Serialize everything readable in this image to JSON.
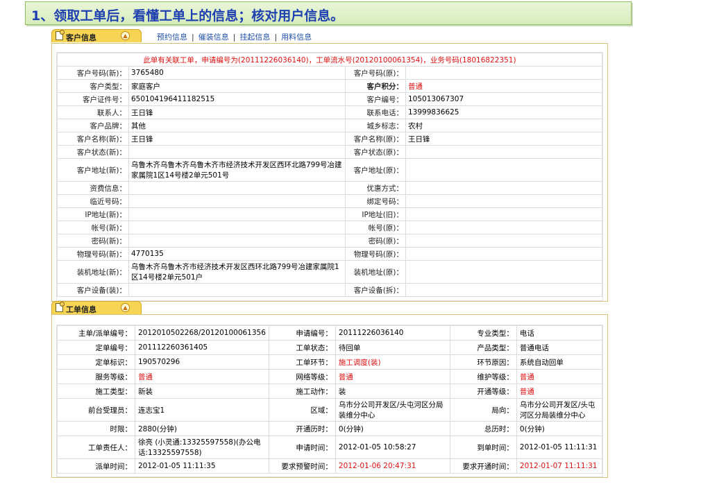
{
  "banner": {
    "title": "1、领取工单后，看懂工单上的信息；核对用户信息。"
  },
  "customer_tabs": {
    "active": "客户信息",
    "links": [
      "预约信息",
      "催装信息",
      "挂起信息",
      "用料信息"
    ]
  },
  "customer_notice": "此单有关联工单，申请编号为(20111226036140)，工单流水号(20120100061354)，业务号码(18016822351)",
  "customer_rows": [
    [
      {
        "l": "客户号码(新)：",
        "v": ""
      },
      {
        "l": "3765480",
        "v": ""
      }
    ],
    [
      {
        "l": "客户号码(新)：",
        "v": "3765480"
      },
      {
        "l": "客户号码(原)：",
        "v": ""
      }
    ],
    [
      {
        "l": "客户类型：",
        "v": "家庭客户"
      },
      {
        "l": "客户积分：",
        "v": "普通",
        "bold": true,
        "red": true
      }
    ],
    [
      {
        "l": "客户证件号：",
        "v": "650104196411182515"
      },
      {
        "l": "客户编号：",
        "v": "105013067307"
      }
    ],
    [
      {
        "l": "联系人：",
        "v": "王日锋"
      },
      {
        "l": "联系电话：",
        "v": "13999836625"
      }
    ],
    [
      {
        "l": "客户品牌：",
        "v": "其他"
      },
      {
        "l": "城乡标志：",
        "v": "农村"
      }
    ],
    [
      {
        "l": "客户名称(新)：",
        "v": "王日锋"
      },
      {
        "l": "客户名称(原)：",
        "v": "王日锋"
      }
    ],
    [
      {
        "l": "客户状态(新)：",
        "v": ""
      },
      {
        "l": "客户状态(原)：",
        "v": ""
      }
    ],
    [
      {
        "l": "客户地址(新)：",
        "v": "乌鲁木齐乌鲁木齐乌鲁木齐市经济技术开发区西环北路799号冶建家属院1区14号楼2单元501号"
      },
      {
        "l": "客户地址(原)：",
        "v": ""
      }
    ],
    [
      {
        "l": "资费信息：",
        "v": ""
      },
      {
        "l": "优惠方式：",
        "v": ""
      }
    ],
    [
      {
        "l": "临近号码：",
        "v": ""
      },
      {
        "l": "绑定号码：",
        "v": ""
      }
    ],
    [
      {
        "l": "IP地址(新)：",
        "v": ""
      },
      {
        "l": "IP地址(旧)：",
        "v": ""
      }
    ],
    [
      {
        "l": "帐号(新)：",
        "v": ""
      },
      {
        "l": "帐号(原)：",
        "v": ""
      }
    ],
    [
      {
        "l": "密码(新)：",
        "v": ""
      },
      {
        "l": "密码(原)：",
        "v": ""
      }
    ],
    [
      {
        "l": "物理号码(新)：",
        "v": "4770135"
      },
      {
        "l": "物理号码(原)：",
        "v": ""
      }
    ],
    [
      {
        "l": "装机地址(新)：",
        "v": "乌鲁木齐乌鲁木齐市经济技术开发区西环北路799号冶建家属院1区14号楼2单元501户"
      },
      {
        "l": "装机地址(原)：",
        "v": ""
      }
    ],
    [
      {
        "l": "客户设备(装)：",
        "v": ""
      },
      {
        "l": "客户设备(拆)：",
        "v": ""
      }
    ]
  ],
  "order_tabs": {
    "active": "工单信息"
  },
  "order_rows": [
    [
      {
        "l": "主单/派单编号：",
        "v": "2012010502268/20120100061356"
      },
      {
        "l": "申请编号：",
        "v": "20111226036140"
      },
      {
        "l": "专业类型：",
        "v": "电话"
      }
    ],
    [
      {
        "l": "定单编号：",
        "v": "201112260361405"
      },
      {
        "l": "工单状态：",
        "v": "待回单"
      },
      {
        "l": "产品类型：",
        "v": "普通电话"
      }
    ],
    [
      {
        "l": "定单标识：",
        "v": "190570296"
      },
      {
        "l": "工单环节：",
        "v": "施工调度(装)",
        "red": true
      },
      {
        "l": "环节原因：",
        "v": "系统自动回单"
      }
    ],
    [
      {
        "l": "服务等级：",
        "v": "普通",
        "red": true
      },
      {
        "l": "网络等级：",
        "v": "普通",
        "red": true
      },
      {
        "l": "维护等级：",
        "v": "普通",
        "red": true
      }
    ],
    [
      {
        "l": "施工类型：",
        "v": "新装"
      },
      {
        "l": "施工动作：",
        "v": "装"
      },
      {
        "l": "开通等级：",
        "v": "普通",
        "red": true
      }
    ],
    [
      {
        "l": "前台受理员：",
        "v": "连志宝1"
      },
      {
        "l": "区域：",
        "v": "乌市分公司开发区/头屯河区分局装维分中心"
      },
      {
        "l": "局向：",
        "v": "乌市分公司开发区/头屯河区分局装维分中心"
      }
    ],
    [
      {
        "l": "时限：",
        "v": "2880(分钟)"
      },
      {
        "l": "开通历时：",
        "v": "0(分钟)"
      },
      {
        "l": "总历时：",
        "v": "0(分钟)"
      }
    ],
    [
      {
        "l": "工单责任人：",
        "v": "徐亮 (小灵通:13325597558)(办公电话:13325597558)"
      },
      {
        "l": "申请时间：",
        "v": "2012-01-05 10:58:27"
      },
      {
        "l": "到单时间：",
        "v": "2012-01-05 11:11:31"
      }
    ],
    [
      {
        "l": "派单时间：",
        "v": "2012-01-05 11:11:35"
      },
      {
        "l": "要求预警时间：",
        "v": "2012-01-06 20:47:31",
        "red": true
      },
      {
        "l": "要求开通时间：",
        "v": "2012-01-07 11:11:31",
        "red": true
      }
    ]
  ]
}
